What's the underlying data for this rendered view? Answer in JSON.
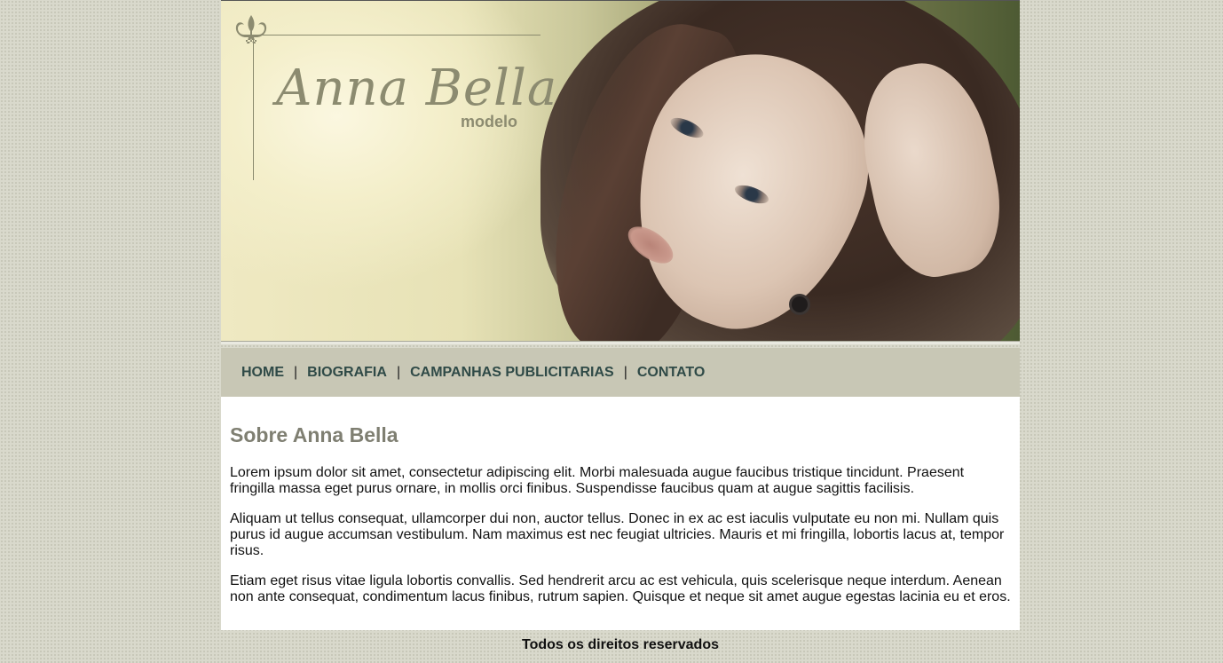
{
  "header": {
    "logo_name": "Anna Bella",
    "logo_sub": "modelo",
    "ornament_icon": "fleur-de-lis-icon"
  },
  "nav": {
    "items": [
      {
        "label": "HOME"
      },
      {
        "label": "BIOGRAFIA"
      },
      {
        "label": "CAMPANHAS PUBLICITARIAS"
      },
      {
        "label": "CONTATO"
      }
    ],
    "separator": "|"
  },
  "main": {
    "title": "Sobre Anna Bella",
    "paragraphs": [
      "Lorem ipsum dolor sit amet, consectetur adipiscing elit. Morbi malesuada augue faucibus tristique tincidunt. Praesent fringilla massa eget purus ornare, in mollis orci finibus. Suspendisse faucibus quam at augue sagittis facilisis.",
      "Aliquam ut tellus consequat, ullamcorper dui non, auctor tellus. Donec in ex ac est iaculis vulputate eu non mi. Nullam quis purus id augue accumsan vestibulum. Nam maximus est nec feugiat ultricies. Mauris et mi fringilla, lobortis lacus at, tempor risus.",
      "Etiam eget risus vitae ligula lobortis convallis. Sed hendrerit arcu ac est vehicula, quis scelerisque neque interdum. Aenean non ante consequat, condimentum lacus finibus, rutrum sapien. Quisque et neque sit amet augue egestas lacinia eu et eros."
    ]
  },
  "footer": {
    "text": "Todos os direitos reservados"
  },
  "colors": {
    "nav_bg": "#c8c7b5",
    "nav_text": "#2f4a47",
    "title": "#7f7f72",
    "logo": "#8c8b70"
  }
}
